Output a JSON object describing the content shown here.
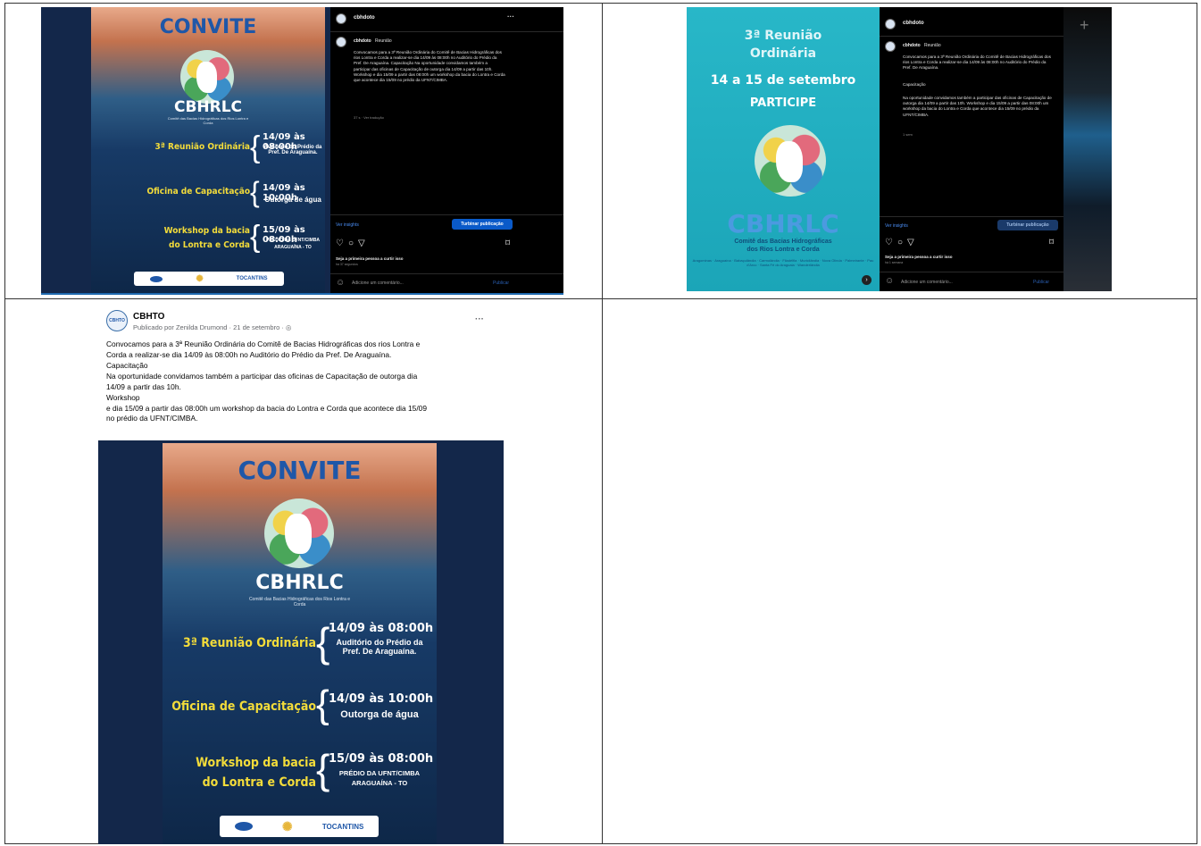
{
  "poster": {
    "convite": "CONVITE",
    "brand": "CBHRLC",
    "brand_sub": "Comitê das Bacias Hidrográficas dos Rios Lontra e Corda",
    "item1_title": "3ª Reunião Ordinária",
    "item1_date": "14/09 às 08:00h",
    "item1_note": "Auditório do Prédio da Pref. De Araguaína.",
    "item2_title": "Oficina de Capacitação",
    "item2_date": "14/09 às 10:00h",
    "item2_note": "Outorga de água",
    "item3_title_1": "Workshop da bacia",
    "item3_title_2": "do Lontra e Corda",
    "item3_date": "15/09 às 08:00h",
    "item3_note_1": "PRÉDIO DA UFNT/CIMBA",
    "item3_note_2": "ARAGUAÍNA - TO",
    "sponsor_state": "TOCANTINS"
  },
  "ig1": {
    "username": "cbhdoto",
    "caption_user": "cbhdoto",
    "caption_word": "Reunião",
    "caption": "Convocamos para a 3ª Reunião Ordinária do Comitê de Bacias Hidrográficas dos rios Lontra e Corda a realizar-se dia 14/09 às 08:00h no Auditório do Prédio da Pref. De Araguaína. Capacitação Na oportunidade convidamos também a participar das oficinas de Capacitação de outorga dia 14/09 a partir das 10h. Workshop e dia 15/09 a partir das 08:00h um workshop da bacia do Lontra e Corda que acontece dia 15/09 no prédio da UFNT/CIMBA.",
    "meta": "37 s · Ver tradução",
    "insights": "Ver insights",
    "boost": "Turbinar publicação",
    "likes": "Seja a primeira pessoa a curtir isso",
    "date": "há 37 segundos",
    "comment_placeholder": "Adicione um comentário...",
    "publish": "Publicar"
  },
  "teal": {
    "line1": "3ª Reunião",
    "line2": "Ordinária",
    "dates": "14 a 15 de setembro",
    "cta": "PARTICIPE",
    "brand": "CBHRLC",
    "sub1": "Comitê das Bacias Hidrográficas",
    "sub2": "dos Rios Lontra e Corda",
    "cities": "Aragominas · Araguaína · Babaçulândia · Carmolândia · Filadélfia · Muricilândia · Nova Olinda · Palmeirante · Pau d'Arco · Santa Fé do Araguaia · Wanderlândia"
  },
  "ig2": {
    "username": "cbhdoto",
    "caption_user": "cbhdoto",
    "caption_word": "Reunião",
    "caption1": "Convocamos para a 3ª Reunião Ordinária do Comitê de Bacias Hidrográficas dos rios Lontra e Corda a realizar-se dia 14/09 às 08:00h no Auditório do Prédio da Pref. De Araguaína.",
    "caption2": "Capacitação",
    "caption3": "Na oportunidade convidamos também a participar das oficinas de Capacitação de outorga dia 14/09 a partir das 10h. Workshop e dia 15/09 a partir das 08:00h um workshop da bacia do Lontra e Corda que acontece dia 15/09 no prédio da UFNT/CIMBA.",
    "meta": "1 sem",
    "insights": "Ver insights",
    "boost": "Turbinar publicação",
    "likes": "Seja a primeira pessoa a curtir isso",
    "date": "há 1 semana",
    "comment_placeholder": "Adicione um comentário...",
    "publish": "Publicar"
  },
  "fb": {
    "page": "CBHTO",
    "avatar": "CBHTO",
    "byline": "Publicado por Zenilda Drumond · 21 de setembro · ",
    "more": "···",
    "line1": "Convocamos para a 3ª Reunião Ordinária do Comitê de Bacias Hidrográficas dos rios Lontra e",
    "line2": "Corda a realizar-se dia 14/09 às 08:00h no Auditório do Prédio da Pref. De Araguaína.",
    "line3": "Capacitação",
    "line4": "Na oportunidade convidamos também a participar das oficinas de Capacitação de outorga dia",
    "line5": "14/09 a partir das 10h.",
    "line6": "Workshop",
    "line7": "e dia 15/09 a partir das 08:00h um workshop da bacia do Lontra e Corda que acontece dia 15/09",
    "line8": "no prédio da UFNT/CIMBA."
  }
}
